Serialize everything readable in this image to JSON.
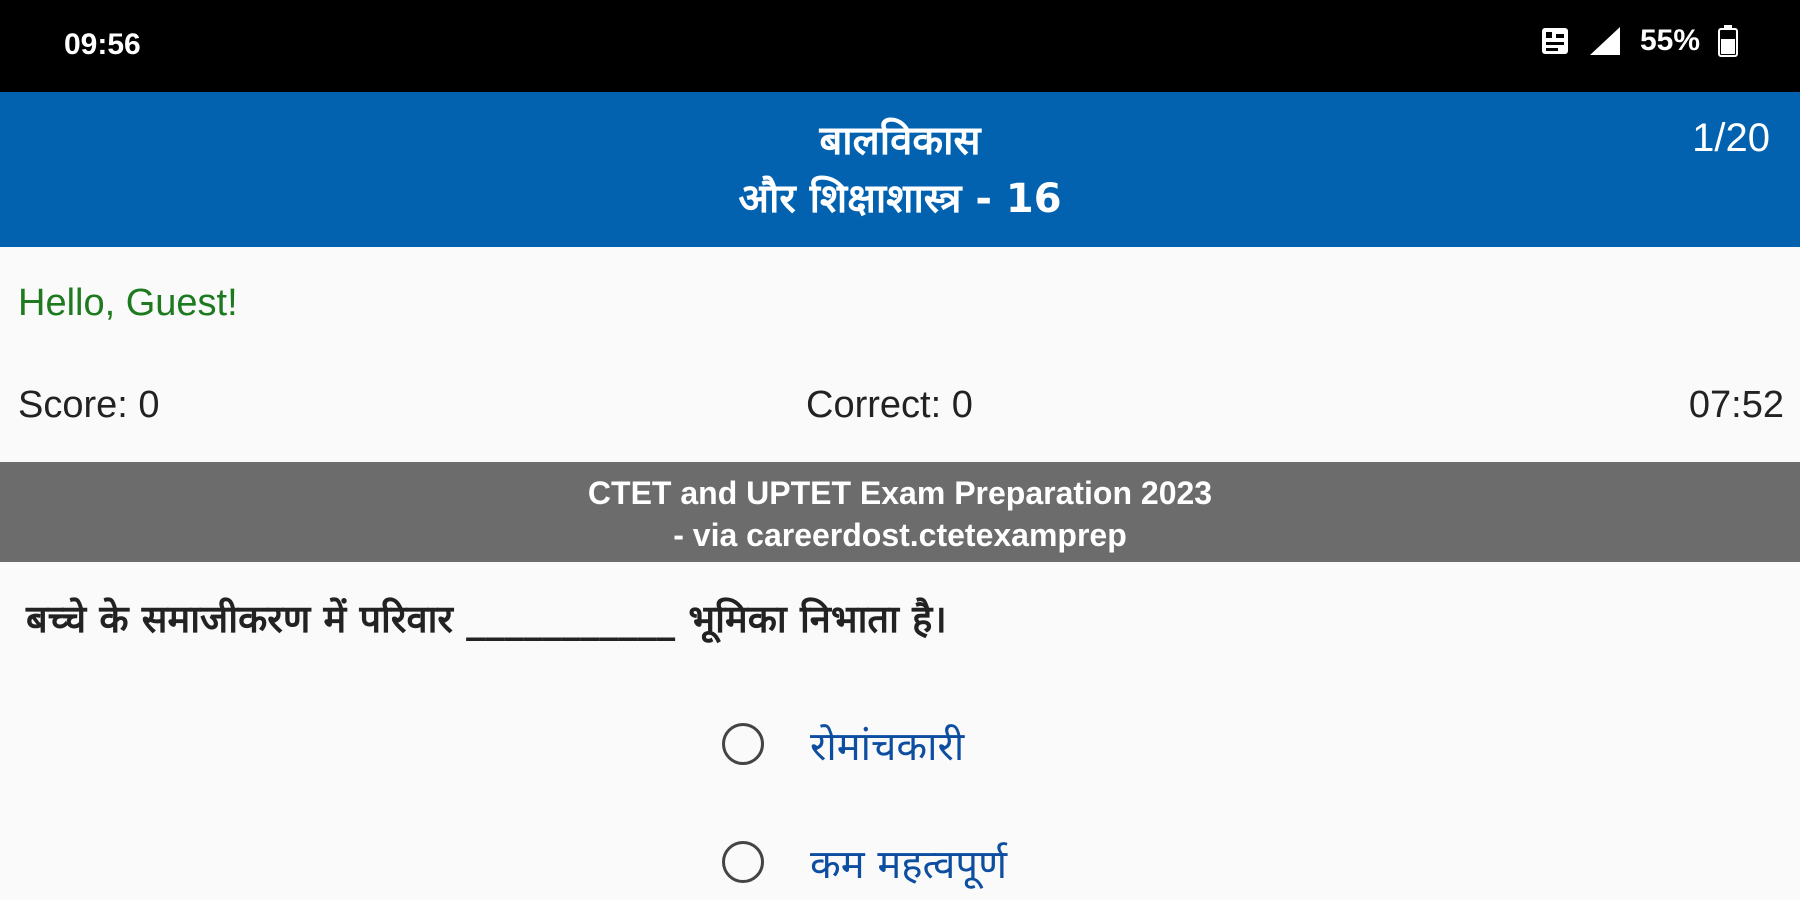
{
  "status_bar": {
    "time": "09:56",
    "battery": "55%",
    "icons": [
      "vpn-key-icon",
      "signal-icon",
      "battery-icon"
    ]
  },
  "header": {
    "title_line1": "बालविकास",
    "title_line2": "और शिक्षाशास्त्र - 16",
    "progress": "1/20",
    "background_color": "#0262b0"
  },
  "greeting": "Hello, Guest!",
  "stats": {
    "score": "Score: 0",
    "correct": "Correct: 0",
    "timer": "07:52"
  },
  "banner": {
    "line1": "CTET and UPTET Exam Preparation 2023",
    "line2": "- via careerdost.ctetexamprep"
  },
  "question": {
    "text": "बच्चे के समाजीकरण में परिवार ___________ भूमिका निभाता है।",
    "options": [
      {
        "label": "रोमांचकारी"
      },
      {
        "label": "कम महत्वपूर्ण"
      }
    ]
  }
}
